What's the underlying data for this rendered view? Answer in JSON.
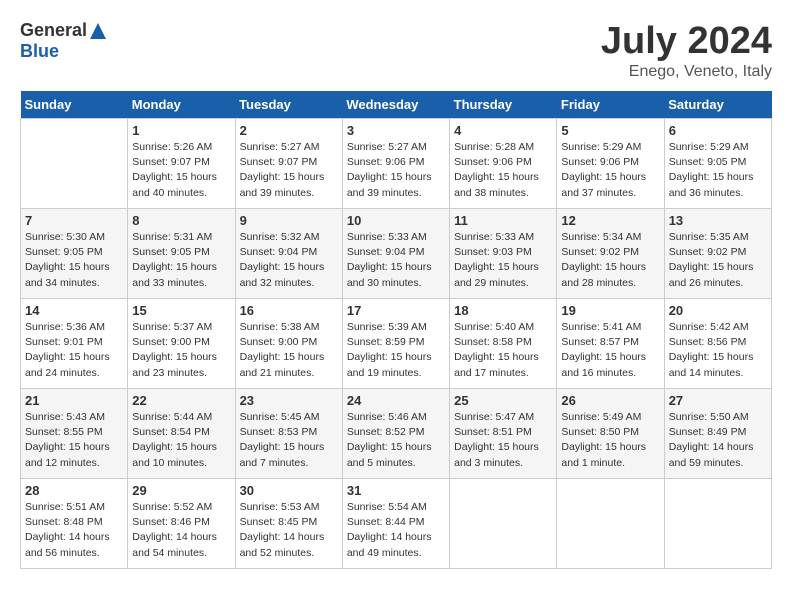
{
  "header": {
    "logo_general": "General",
    "logo_blue": "Blue",
    "month_title": "July 2024",
    "subtitle": "Enego, Veneto, Italy"
  },
  "days_of_week": [
    "Sunday",
    "Monday",
    "Tuesday",
    "Wednesday",
    "Thursday",
    "Friday",
    "Saturday"
  ],
  "weeks": [
    [
      {
        "num": "",
        "detail": ""
      },
      {
        "num": "1",
        "detail": "Sunrise: 5:26 AM\nSunset: 9:07 PM\nDaylight: 15 hours\nand 40 minutes."
      },
      {
        "num": "2",
        "detail": "Sunrise: 5:27 AM\nSunset: 9:07 PM\nDaylight: 15 hours\nand 39 minutes."
      },
      {
        "num": "3",
        "detail": "Sunrise: 5:27 AM\nSunset: 9:06 PM\nDaylight: 15 hours\nand 39 minutes."
      },
      {
        "num": "4",
        "detail": "Sunrise: 5:28 AM\nSunset: 9:06 PM\nDaylight: 15 hours\nand 38 minutes."
      },
      {
        "num": "5",
        "detail": "Sunrise: 5:29 AM\nSunset: 9:06 PM\nDaylight: 15 hours\nand 37 minutes."
      },
      {
        "num": "6",
        "detail": "Sunrise: 5:29 AM\nSunset: 9:05 PM\nDaylight: 15 hours\nand 36 minutes."
      }
    ],
    [
      {
        "num": "7",
        "detail": "Sunrise: 5:30 AM\nSunset: 9:05 PM\nDaylight: 15 hours\nand 34 minutes."
      },
      {
        "num": "8",
        "detail": "Sunrise: 5:31 AM\nSunset: 9:05 PM\nDaylight: 15 hours\nand 33 minutes."
      },
      {
        "num": "9",
        "detail": "Sunrise: 5:32 AM\nSunset: 9:04 PM\nDaylight: 15 hours\nand 32 minutes."
      },
      {
        "num": "10",
        "detail": "Sunrise: 5:33 AM\nSunset: 9:04 PM\nDaylight: 15 hours\nand 30 minutes."
      },
      {
        "num": "11",
        "detail": "Sunrise: 5:33 AM\nSunset: 9:03 PM\nDaylight: 15 hours\nand 29 minutes."
      },
      {
        "num": "12",
        "detail": "Sunrise: 5:34 AM\nSunset: 9:02 PM\nDaylight: 15 hours\nand 28 minutes."
      },
      {
        "num": "13",
        "detail": "Sunrise: 5:35 AM\nSunset: 9:02 PM\nDaylight: 15 hours\nand 26 minutes."
      }
    ],
    [
      {
        "num": "14",
        "detail": "Sunrise: 5:36 AM\nSunset: 9:01 PM\nDaylight: 15 hours\nand 24 minutes."
      },
      {
        "num": "15",
        "detail": "Sunrise: 5:37 AM\nSunset: 9:00 PM\nDaylight: 15 hours\nand 23 minutes."
      },
      {
        "num": "16",
        "detail": "Sunrise: 5:38 AM\nSunset: 9:00 PM\nDaylight: 15 hours\nand 21 minutes."
      },
      {
        "num": "17",
        "detail": "Sunrise: 5:39 AM\nSunset: 8:59 PM\nDaylight: 15 hours\nand 19 minutes."
      },
      {
        "num": "18",
        "detail": "Sunrise: 5:40 AM\nSunset: 8:58 PM\nDaylight: 15 hours\nand 17 minutes."
      },
      {
        "num": "19",
        "detail": "Sunrise: 5:41 AM\nSunset: 8:57 PM\nDaylight: 15 hours\nand 16 minutes."
      },
      {
        "num": "20",
        "detail": "Sunrise: 5:42 AM\nSunset: 8:56 PM\nDaylight: 15 hours\nand 14 minutes."
      }
    ],
    [
      {
        "num": "21",
        "detail": "Sunrise: 5:43 AM\nSunset: 8:55 PM\nDaylight: 15 hours\nand 12 minutes."
      },
      {
        "num": "22",
        "detail": "Sunrise: 5:44 AM\nSunset: 8:54 PM\nDaylight: 15 hours\nand 10 minutes."
      },
      {
        "num": "23",
        "detail": "Sunrise: 5:45 AM\nSunset: 8:53 PM\nDaylight: 15 hours\nand 7 minutes."
      },
      {
        "num": "24",
        "detail": "Sunrise: 5:46 AM\nSunset: 8:52 PM\nDaylight: 15 hours\nand 5 minutes."
      },
      {
        "num": "25",
        "detail": "Sunrise: 5:47 AM\nSunset: 8:51 PM\nDaylight: 15 hours\nand 3 minutes."
      },
      {
        "num": "26",
        "detail": "Sunrise: 5:49 AM\nSunset: 8:50 PM\nDaylight: 15 hours\nand 1 minute."
      },
      {
        "num": "27",
        "detail": "Sunrise: 5:50 AM\nSunset: 8:49 PM\nDaylight: 14 hours\nand 59 minutes."
      }
    ],
    [
      {
        "num": "28",
        "detail": "Sunrise: 5:51 AM\nSunset: 8:48 PM\nDaylight: 14 hours\nand 56 minutes."
      },
      {
        "num": "29",
        "detail": "Sunrise: 5:52 AM\nSunset: 8:46 PM\nDaylight: 14 hours\nand 54 minutes."
      },
      {
        "num": "30",
        "detail": "Sunrise: 5:53 AM\nSunset: 8:45 PM\nDaylight: 14 hours\nand 52 minutes."
      },
      {
        "num": "31",
        "detail": "Sunrise: 5:54 AM\nSunset: 8:44 PM\nDaylight: 14 hours\nand 49 minutes."
      },
      {
        "num": "",
        "detail": ""
      },
      {
        "num": "",
        "detail": ""
      },
      {
        "num": "",
        "detail": ""
      }
    ]
  ]
}
